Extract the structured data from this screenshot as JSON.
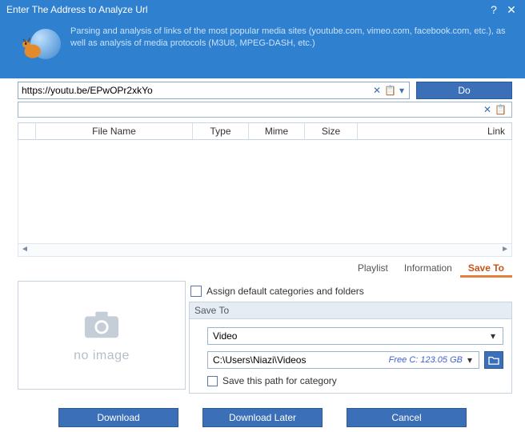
{
  "titlebar": {
    "title": "Enter The Address to Analyze Url"
  },
  "description": "Parsing and analysis of links of the most popular media sites (youtube.com, vimeo.com, facebook.com, etc.), as well as analysis of media protocols (M3U8, MPEG-DASH, etc.)",
  "url_input": {
    "value": "https://youtu.be/EPwOPr2xkYo"
  },
  "do_button": "Do",
  "filter_input": {
    "value": ""
  },
  "grid": {
    "headers": [
      "",
      "File Name",
      "Type",
      "Mime",
      "Size",
      "Link"
    ]
  },
  "tabs": [
    "Playlist",
    "Information",
    "Save To"
  ],
  "preview": {
    "no_image": "no image"
  },
  "assign_label": "Assign default categories and folders",
  "saveto": {
    "title": "Save To",
    "category": "Video",
    "path": "C:\\Users\\Niazi\\Videos",
    "free_space": "Free C: 123.05 GB",
    "save_path_label": "Save this path for category"
  },
  "buttons": {
    "download": "Download",
    "later": "Download Later",
    "cancel": "Cancel"
  }
}
